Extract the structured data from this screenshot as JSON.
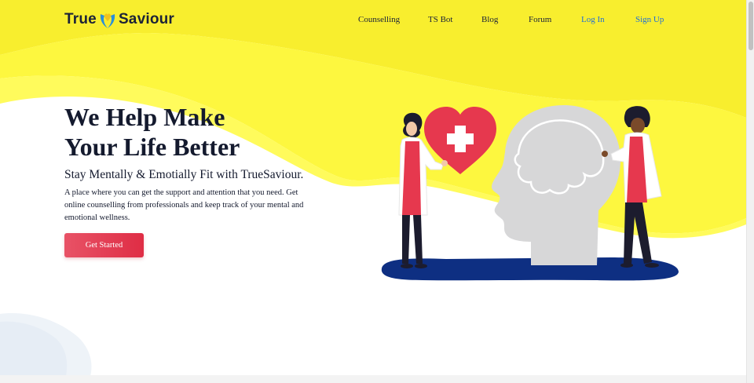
{
  "brand": {
    "name_left": "True",
    "name_right": "Saviour",
    "logo_icon": "hands-heart-logo-icon"
  },
  "nav": {
    "items": [
      {
        "label": "Counselling"
      },
      {
        "label": "TS Bot"
      },
      {
        "label": "Blog"
      },
      {
        "label": "Forum"
      },
      {
        "label": "Log In"
      },
      {
        "label": "Sign Up"
      }
    ]
  },
  "hero": {
    "title_line1": "We Help Make",
    "title_line2": "Your Life Better",
    "subtitle": "Stay Mentally & Emotially Fit with TrueSaviour.",
    "description": "A place where you can get the support and attention that you need. Get online counselling from professionals and keep track of your mental and emotional wellness.",
    "cta_label": "Get Started"
  },
  "colors": {
    "accent_yellow": "#fbf43a",
    "cta_red": "#e2364c",
    "link_blue": "#1f6fd6",
    "text_dark": "#141a2e",
    "navy": "#0e2f82"
  }
}
